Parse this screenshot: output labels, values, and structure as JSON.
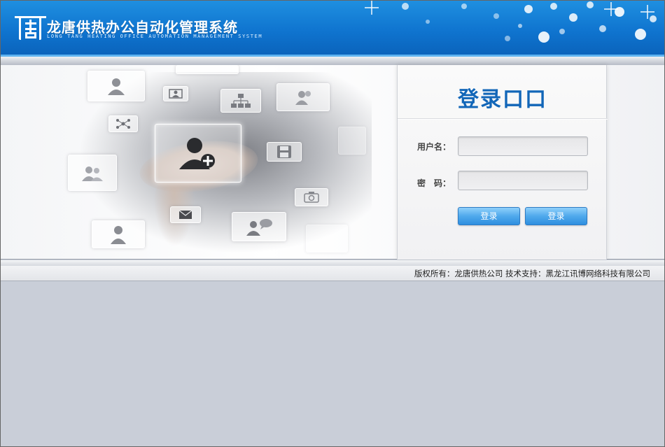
{
  "header": {
    "title": "龙唐供热办公自动化管理系统",
    "subtitle": "LONG TANG HEATING OFFICE AUTOMATION MANAGEMENT SYSTEM",
    "logo_icon": "tang-logo-icon"
  },
  "login": {
    "title": "登录口口",
    "username_label": "用户名：",
    "password_label": "密　码：",
    "username_value": "",
    "password_value": "",
    "login_button_label": "登录",
    "second_button_label": "登录"
  },
  "hero_icons": [
    "user-icon",
    "id-card-icon",
    "org-chart-icon",
    "contact-icon",
    "network-icon",
    "add-user-icon",
    "save-icon",
    "group-icon",
    "camera-icon",
    "mail-icon",
    "chat-user-icon",
    "person-icon"
  ],
  "footer": {
    "copyright": "版权所有：龙唐供热公司  技术支持：黑龙江讯博网络科技有限公司"
  },
  "colors": {
    "header_blue": "#0f74cf",
    "title_blue": "#1266b8",
    "button_blue": "#4fa9ec",
    "page_bg": "#c9ced8"
  }
}
